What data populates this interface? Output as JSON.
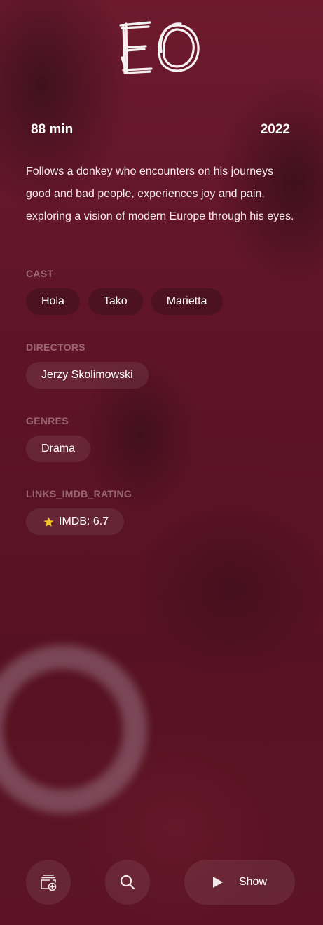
{
  "movie": {
    "logo_text": "EO",
    "duration": "88 min",
    "year": "2022",
    "description": "Follows a donkey who encounters on his journeys good and bad people, experiences joy and pain, exploring a vision of modern Europe through his eyes."
  },
  "cast": {
    "label": "CAST",
    "items": [
      "Hola",
      "Tako",
      "Marietta"
    ]
  },
  "directors": {
    "label": "DIRECTORS",
    "items": [
      "Jerzy Skolimowski"
    ]
  },
  "genres": {
    "label": "GENRES",
    "items": [
      "Drama"
    ]
  },
  "rating": {
    "label": "LINKS_IMDB_RATING",
    "text": "IMDB: 6.7",
    "icon": "star-icon",
    "star_color": "#f2c230"
  },
  "actions": {
    "watchlist_icon": "add-to-watchlist-icon",
    "search_icon": "search-icon",
    "show_label": "Show",
    "show_icon": "play-icon"
  },
  "colors": {
    "background": "#5a1424",
    "chip_bg": "rgba(255,255,255,0.08)"
  }
}
